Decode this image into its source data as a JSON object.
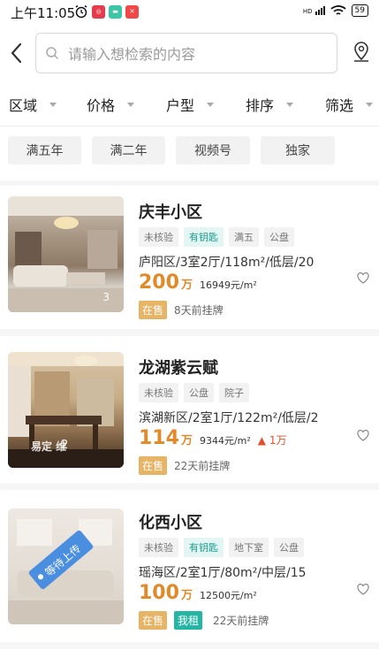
{
  "status_bar": {
    "time": "上午11:05",
    "battery": "59",
    "network": "HD"
  },
  "search": {
    "placeholder": "请输入想检索的内容"
  },
  "filters": [
    "区域",
    "价格",
    "户型",
    "排序",
    "筛选"
  ],
  "quick_tags": [
    "满五年",
    "满二年",
    "视频号",
    "独家"
  ],
  "listings": [
    {
      "title": "庆丰小区",
      "labels": [
        {
          "text": "未核验",
          "style": "plain"
        },
        {
          "text": "有钥匙",
          "style": "key"
        },
        {
          "text": "满五",
          "style": "plain"
        },
        {
          "text": "公盘",
          "style": "plain"
        }
      ],
      "desc": "庐阳区/3室2厅/118m²/低层/20",
      "price": "200",
      "price_unit": "万",
      "unit_price": "16949元/m²",
      "rise": "",
      "status": "在售",
      "rent_badge": "",
      "listed": "8天前挂牌",
      "photo_count": "3"
    },
    {
      "title": "龙湖紫云赋",
      "labels": [
        {
          "text": "未核验",
          "style": "plain"
        },
        {
          "text": "公盘",
          "style": "plain"
        },
        {
          "text": "院子",
          "style": "plain"
        }
      ],
      "desc": "滨湖新区/2室1厅/122m²/低层/2",
      "price": "114",
      "price_unit": "万",
      "unit_price": "9344元/m²",
      "rise": "▲ 1万",
      "status": "在售",
      "rent_badge": "",
      "listed": "22天前挂牌",
      "photo_count": "2",
      "watermark": "易定 维"
    },
    {
      "title": "化西小区",
      "labels": [
        {
          "text": "未核验",
          "style": "plain"
        },
        {
          "text": "有钥匙",
          "style": "key"
        },
        {
          "text": "地下室",
          "style": "plain"
        },
        {
          "text": "公盘",
          "style": "plain"
        }
      ],
      "desc": "瑶海区/2室1厅/80m²/中层/15",
      "price": "100",
      "price_unit": "万",
      "unit_price": "12500元/m²",
      "rise": "",
      "status": "在售",
      "rent_badge": "我租",
      "listed": "22天前挂牌",
      "photo_count": "",
      "placeholder_tag": "等待上传"
    }
  ],
  "colors": {
    "price": "#e08a2a",
    "key_tag": "#1a9e8f",
    "onsale": "#e7b365",
    "rent": "#25b5a5"
  }
}
